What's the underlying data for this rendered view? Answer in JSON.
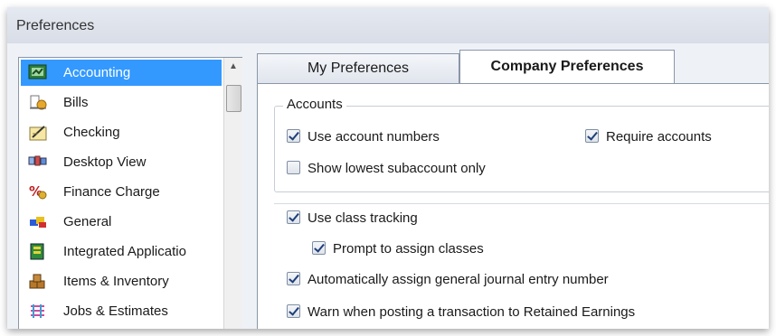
{
  "window": {
    "title": "Preferences"
  },
  "sidebar": {
    "items": [
      {
        "label": "Accounting",
        "icon": "accounting-icon",
        "selected": true
      },
      {
        "label": "Bills",
        "icon": "bills-icon"
      },
      {
        "label": "Checking",
        "icon": "checking-icon"
      },
      {
        "label": "Desktop View",
        "icon": "desktop-view-icon"
      },
      {
        "label": "Finance Charge",
        "icon": "finance-charge-icon"
      },
      {
        "label": "General",
        "icon": "general-icon"
      },
      {
        "label": "Integrated Applicatio",
        "icon": "integrated-applications-icon"
      },
      {
        "label": "Items & Inventory",
        "icon": "items-inventory-icon"
      },
      {
        "label": "Jobs & Estimates",
        "icon": "jobs-estimates-icon"
      }
    ]
  },
  "tabs": {
    "my_preferences": "My Preferences",
    "company_preferences": "Company Preferences"
  },
  "accounts": {
    "title": "Accounts",
    "use_account_numbers": {
      "label": "Use account numbers",
      "checked": true
    },
    "require_accounts": {
      "label": "Require accounts",
      "checked": true
    },
    "show_lowest_subaccount": {
      "label": "Show lowest subaccount only",
      "checked": false
    }
  },
  "options": {
    "use_class_tracking": {
      "label": "Use class tracking",
      "checked": true
    },
    "prompt_assign_classes": {
      "label": "Prompt to assign classes",
      "checked": true
    },
    "auto_assign_journal": {
      "label": "Automatically assign general journal entry number",
      "checked": true
    },
    "warn_retained_earnings": {
      "label": "Warn when posting a transaction to Retained Earnings",
      "checked": true
    }
  }
}
